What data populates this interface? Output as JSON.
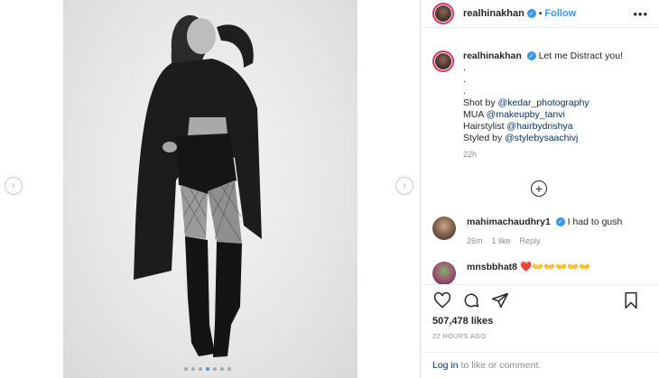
{
  "post": {
    "username": "realhinakhan",
    "follow_label": "Follow",
    "separator": "•",
    "more_label": "•••",
    "caption": {
      "username": "realhinakhan",
      "first_line": "Let me Distract you!",
      "dot_lines": [
        ".",
        ".",
        "."
      ],
      "credits": [
        {
          "prefix": "Shot by ",
          "mention": "@kedar_photography"
        },
        {
          "prefix": "MUA ",
          "mention": "@makeupby_tanvi"
        },
        {
          "prefix": "Hairstylist ",
          "mention": "@hairbydrishya"
        },
        {
          "prefix": "Styled by ",
          "mention": "@stylebysaachivj"
        }
      ],
      "time": "22h"
    },
    "load_more_label": "+",
    "comments": [
      {
        "username": "mahimachaudhry1",
        "text": "I had to gush",
        "time": "26m",
        "likes": "1 like",
        "reply": "Reply"
      },
      {
        "username": "mnsbbhat8",
        "text": "❤️👐👐👐👐👐"
      }
    ],
    "likes": "507,478 likes",
    "posted": "22 HOURS AGO",
    "login_link": "Log in",
    "login_rest": "to like or comment."
  },
  "carousel": {
    "prev_label": "‹",
    "next_label": "›",
    "dot_count": 7,
    "active_dot": 3
  },
  "icons": {
    "verified": "verified-badge-icon",
    "like": "heart-icon",
    "comment": "comment-icon",
    "share": "share-icon",
    "save": "bookmark-icon"
  },
  "colors": {
    "accent": "#3897f0",
    "link": "#003569",
    "muted": "#8e8e8e",
    "text": "#262626"
  }
}
